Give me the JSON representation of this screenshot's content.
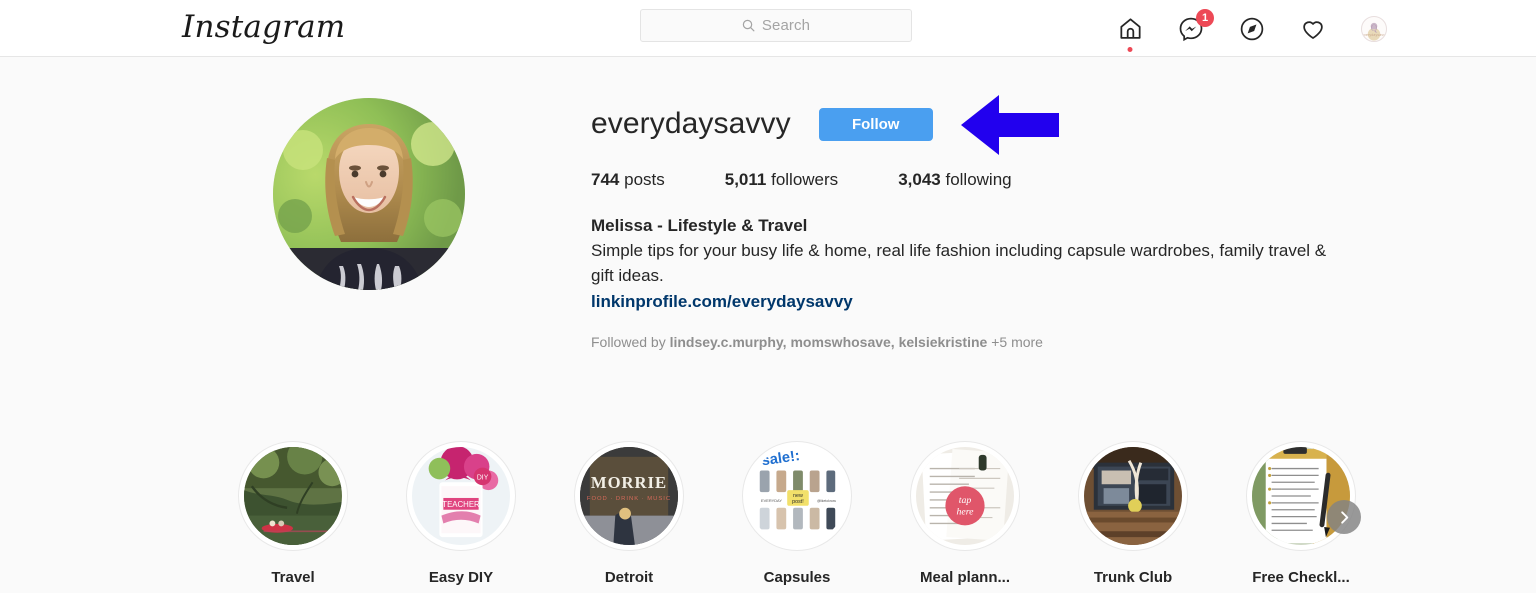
{
  "header": {
    "logo_text": "Instagram",
    "search": {
      "placeholder": "Search",
      "icon": "search-icon",
      "value": ""
    },
    "nav": [
      {
        "name": "home-icon",
        "label": "Home",
        "has_dot": true
      },
      {
        "name": "messenger-icon",
        "label": "Messenger",
        "badge": "1"
      },
      {
        "name": "compass-explore-icon",
        "label": "Explore"
      },
      {
        "name": "heart-activity-icon",
        "label": "Activity"
      },
      {
        "name": "profile-avatar-icon",
        "label": "Profile"
      }
    ],
    "messenger_badge_count": "1"
  },
  "profile": {
    "avatar_alt": "everydaysavvy profile photo",
    "username": "everydaysavvy",
    "follow_button_label": "Follow",
    "stats": [
      {
        "number": "744",
        "label": "posts"
      },
      {
        "number": "5,011",
        "label": "followers"
      },
      {
        "number": "3,043",
        "label": "following"
      }
    ],
    "bio_name": "Melissa - Lifestyle & Travel",
    "bio_text": "Simple tips for your busy life & home, real life fashion including capsule wardrobes, family travel & gift ideas.",
    "bio_link": "linkinprofile.com/everydaysavvy",
    "followed_by": {
      "prefix": "Followed by",
      "users": "lindsey.c.murphy, momswhosave, kelsiekristine",
      "more": "+5 more"
    }
  },
  "highlights": {
    "next_button_icon": "chevron-right-icon",
    "items": [
      {
        "label": "Travel",
        "thumb": "forest-kayak-photo"
      },
      {
        "label": "Easy DIY",
        "thumb": "pink-floral-gift-photo"
      },
      {
        "label": "Detroit",
        "thumb": "morrie-sign-photo"
      },
      {
        "label": "Capsules",
        "thumb": "sale-clothing-grid-photo"
      },
      {
        "label": "Meal plann...",
        "thumb": "tap-here-document-photo"
      },
      {
        "label": "Trunk Club",
        "thumb": "clothing-box-photo"
      },
      {
        "label": "Free Checkl...",
        "thumb": "clipboard-pen-photo"
      }
    ]
  },
  "annotation": {
    "arrow_name": "blue-pointer-arrow",
    "arrow_direction": "left",
    "points_at": "follow-button"
  },
  "colors": {
    "page_background": "#fafafa",
    "header_background": "#ffffff",
    "follow_button": "#4a9ff0",
    "badge_red": "#ed4956",
    "link_blue": "#00376b",
    "annotation_blue": "#2200ee",
    "primary_text": "#262626",
    "secondary_text": "#8e8e8e"
  }
}
